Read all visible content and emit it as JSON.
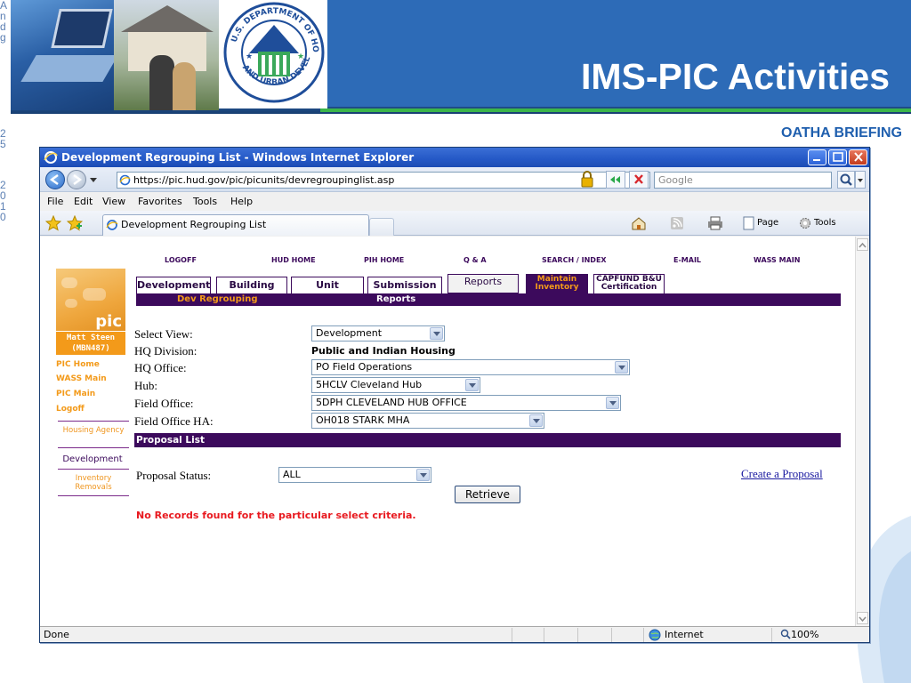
{
  "slide": {
    "title": "IMS-PIC Activities",
    "subtitle": "OATHA BRIEFING",
    "left_sliver_chars": [
      "A",
      "n",
      "d",
      "g",
      "",
      "",
      "",
      "",
      "",
      "",
      "",
      "",
      "2",
      "5",
      "",
      "",
      "",
      "2",
      "0",
      "1",
      "0"
    ]
  },
  "browser": {
    "window_title": "Development Regrouping List - Windows Internet Explorer",
    "address_url": "https://pic.hud.gov/pic/picunits/devregroupinglist.asp",
    "search_placeholder": "Google",
    "menu": [
      "File",
      "Edit",
      "View",
      "Favorites",
      "Tools",
      "Help"
    ],
    "tab_label": "Development Regrouping List",
    "cmd": {
      "page": "Page",
      "tools": "Tools"
    },
    "status_text": "Done",
    "status_zone": "Internet",
    "status_zoom": "100%"
  },
  "page": {
    "top_links": [
      "LOGOFF",
      "HUD HOME",
      "PIH HOME",
      "Q & A",
      "SEARCH / INDEX",
      "E-MAIL",
      "WASS MAIN"
    ],
    "logo_text": "pic",
    "user": {
      "name": "Matt Steen",
      "id": "(MBN487)"
    },
    "left_nav": {
      "pic_home": "PIC Home",
      "wass_main": "WASS Main",
      "pic_main": "PIC Main",
      "logoff": "Logoff",
      "housing_agency": "Housing Agency",
      "development": "Development",
      "inventory_removals": "Inventory Removals"
    },
    "tabs": {
      "development": "Development",
      "building": "Building",
      "unit": "Unit",
      "submission": "Submission",
      "reports": "Reports",
      "maintain_inventory": "Maintain Inventory",
      "capfund": "CAPFUND B&U Certification"
    },
    "subnav": {
      "dev_regrouping": "Dev Regrouping",
      "reports": "Reports"
    },
    "form": {
      "select_view_label": "Select View:",
      "select_view_value": "Development",
      "hq_division_label": "HQ Division:",
      "hq_division_value": "Public and Indian Housing",
      "hq_office_label": "HQ Office:",
      "hq_office_value": "PO Field Operations",
      "hub_label": "Hub:",
      "hub_value": "5HCLV Cleveland Hub",
      "field_office_label": "Field Office:",
      "field_office_value": "5DPH CLEVELAND HUB OFFICE",
      "field_office_ha_label": "Field Office HA:",
      "field_office_ha_value": "OH018 STARK MHA"
    },
    "proposal_list_title": "Proposal List",
    "proposal_status_label": "Proposal Status:",
    "proposal_status_value": "ALL",
    "create_link": "Create a Proposal",
    "retrieve_label": "Retrieve",
    "no_records": "No Records found for the particular select criteria."
  },
  "colors": {
    "header_blue": "#2d6bb7",
    "accent_green": "#3bb54a",
    "pic_purple": "#3c0a5c",
    "pic_orange": "#f39a1a",
    "error_red": "#e8191f"
  }
}
